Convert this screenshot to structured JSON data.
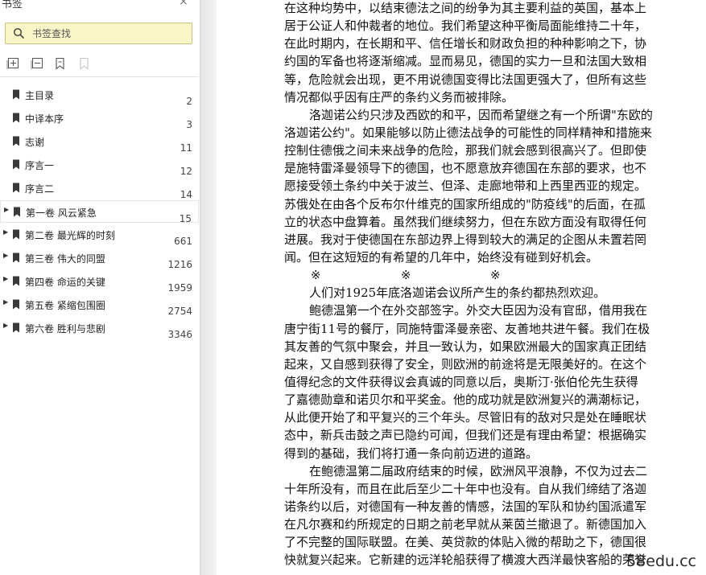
{
  "sidebar": {
    "title": "书签",
    "close_glyph": "×",
    "search": {
      "placeholder": "书签查找",
      "icon": "search-icon"
    },
    "toolbar": [
      {
        "name": "expand-all-button",
        "icon": "expand-all-icon"
      },
      {
        "name": "collapse-all-button",
        "icon": "collapse-all-icon"
      },
      {
        "name": "add-bookmark-button",
        "icon": "add-bookmark-icon"
      },
      {
        "name": "delete-bookmark-button",
        "icon": "bookmark-disabled-icon"
      }
    ],
    "items": [
      {
        "label": "主目录",
        "page": "2",
        "expandable": false
      },
      {
        "label": "中译本序",
        "page": "3",
        "expandable": false
      },
      {
        "label": "志谢",
        "page": "11",
        "expandable": false
      },
      {
        "label": "序言一",
        "page": "12",
        "expandable": false
      },
      {
        "label": "序言二",
        "page": "14",
        "expandable": false
      },
      {
        "label": "第一卷  风云紧急",
        "page": "15",
        "expandable": true,
        "selected": true
      },
      {
        "label": "第二卷  最光辉的时刻",
        "page": "661",
        "expandable": true
      },
      {
        "label": "第三卷  伟大的同盟",
        "page": "1216",
        "expandable": true
      },
      {
        "label": "第四卷  命运的关键",
        "page": "1959",
        "expandable": true
      },
      {
        "label": "第五卷  紧缩包围圈",
        "page": "2754",
        "expandable": true
      },
      {
        "label": "第六卷  胜利与悲剧",
        "page": "3346",
        "expandable": true
      }
    ]
  },
  "document": {
    "lines": [
      {
        "text": "在这种均势中，以结束德法之间的纷争为其主要利益的英国，基本上",
        "indent": false
      },
      {
        "text": "居于公证人和仲裁者的地位。我们希望这种平衡局面能维持二十年，",
        "indent": false
      },
      {
        "text": "在此时期内，在长期和平、信任增长和财政负担的种种影响之下，协",
        "indent": false
      },
      {
        "text": "约国的军备也将逐渐缩减。显而易见，德国的实力一旦和法国大致相",
        "indent": false
      },
      {
        "text": "等，危险就会出现，更不用说德国变得比法国更强大了，但所有这些",
        "indent": false
      },
      {
        "text": "情况都似乎因有庄严的条约义务而被排除。",
        "indent": false
      },
      {
        "text": "洛迦诺公约只涉及西欧的和平，因而希望继之有一个所谓\"东欧的",
        "indent": true
      },
      {
        "text": "洛迦诺公约\"。如果能够以防止德法战争的可能性的同样精神和措施来",
        "indent": false
      },
      {
        "text": "控制住德俄之间未来战争的危险，那我们就会感到很高兴了。但即使",
        "indent": false
      },
      {
        "text": "是施特雷泽曼领导下的德国，也不愿意放弃德国在东部的要求，也不",
        "indent": false
      },
      {
        "text": "愿接受领土条约中关于波兰、但泽、走廊地带和上西里西亚的规定。",
        "indent": false
      },
      {
        "text": "苏俄处在由各个反布尔什维克的国家所组成的\"防疫线\"的后面，在孤",
        "indent": false
      },
      {
        "text": "立的状态中盘算着。虽然我们继续努力，但在东欧方面没有取得任何",
        "indent": false
      },
      {
        "text": "进展。我对于使德国在东部边界上得到较大的满足的企图从未置若罔",
        "indent": false
      },
      {
        "text": "闻。但在这短短的有希望的几年中，始终没有碰到好机会。",
        "indent": false
      },
      {
        "text": "",
        "indent": false,
        "stars": [
          "※",
          "※",
          "※"
        ]
      },
      {
        "text": "人们对1925年底洛迦诺会议所产生的条约都热烈欢迎。",
        "indent": true
      },
      {
        "text": "鲍德温第一个在外交部签字。外交大臣因为没有官邸，借用我在",
        "indent": true
      },
      {
        "text": "唐宁街11号的餐厅，同施特雷泽曼亲密、友善地共进午餐。我们在极",
        "indent": false
      },
      {
        "text": "其友善的气氛中聚会，并且一致认为，如果欧洲最大的国家真正团结",
        "indent": false
      },
      {
        "text": "起来，又自感到获得了安全，则欧洲的前途将是无限美好的。在这个",
        "indent": false
      },
      {
        "text": "值得纪念的文件获得议会真诚的同意以后，奥斯汀·张伯伦先生获得",
        "indent": false
      },
      {
        "text": "了嘉德勋章和诺贝尔和平奖金。他的成功就是欧洲复兴的满潮标记，",
        "indent": false
      },
      {
        "text": "从此便开始了和平复兴的三个年头。尽管旧有的敌对只是处在睡眠状",
        "indent": false
      },
      {
        "text": "态中，新兵击鼓之声已隐约可闻，但我们还是有理由希望：根据确实",
        "indent": false
      },
      {
        "text": "得到的基础，我们将打通一条向前迈进的道路。",
        "indent": false
      },
      {
        "text": "在鲍德温第二届政府结束的时候，欧洲风平浪静，不仅为过去二",
        "indent": true
      },
      {
        "text": "十年所没有，而且在此后至少二十年中也没有。自从我们缔结了洛迦",
        "indent": false
      },
      {
        "text": "诺条约以后，对德国有一种友善的情感，法国的军队和协约国派遣军",
        "indent": false
      },
      {
        "text": "在凡尔赛和约所规定的日期之前老早就从莱茵兰撤退了。新德国加入",
        "indent": false
      },
      {
        "text": "了不完整的国际联盟。在美、英贷款的体贴入微的帮助之下，德国很",
        "indent": false
      },
      {
        "text": "快就复兴起来。它新建的远洋轮船获得了横渡大西洋最快客船的荣誉",
        "indent": false
      }
    ],
    "watermark": "58edu.cc"
  },
  "colors": {
    "search_bg": "#f9f6c7",
    "search_border": "#c9c378",
    "text": "#111111"
  }
}
